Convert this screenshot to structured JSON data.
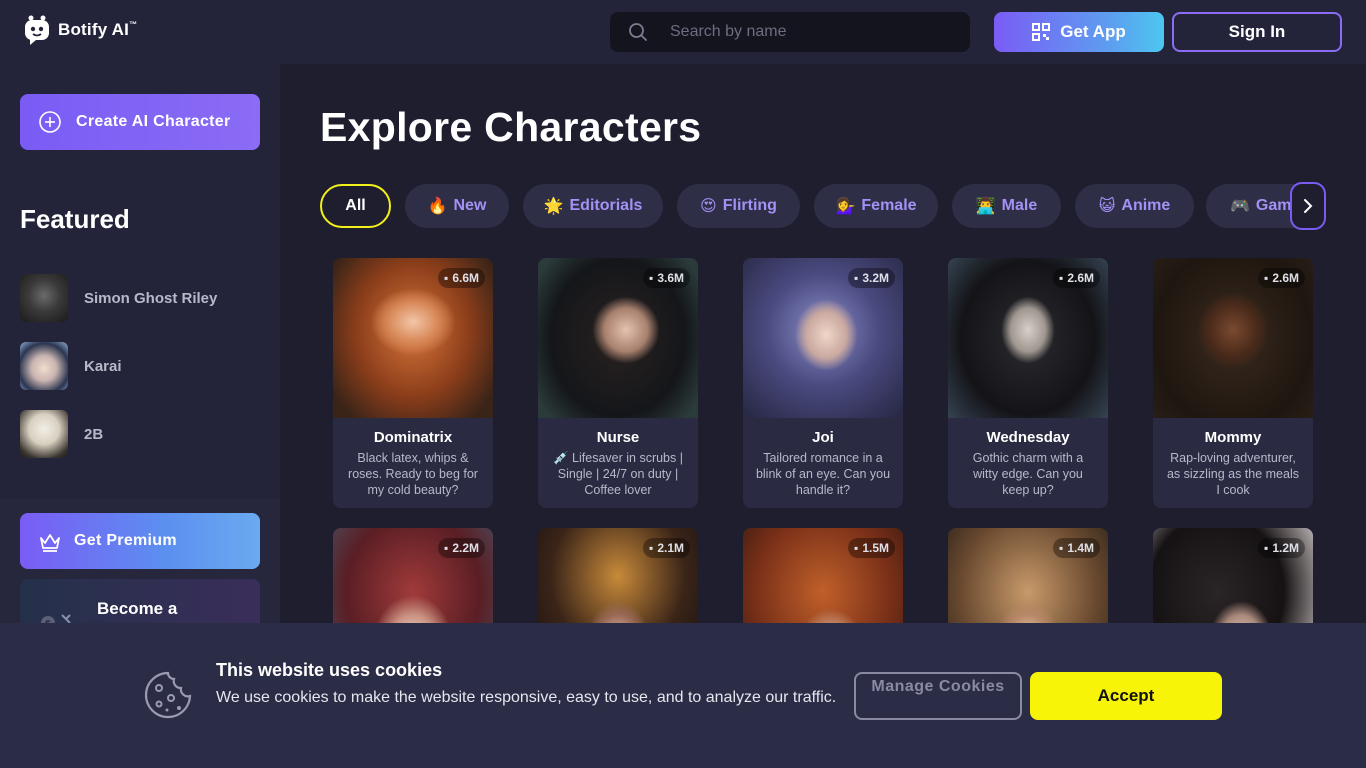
{
  "brand": {
    "name": "Botify AI",
    "tm": "™"
  },
  "search": {
    "placeholder": "Search by name"
  },
  "header": {
    "get_app_label": "Get App",
    "sign_in_label": "Sign In"
  },
  "sidebar": {
    "create_label": "Create AI Character",
    "featured_title": "Featured",
    "featured": [
      {
        "name": "Simon Ghost Riley"
      },
      {
        "name": "Karai"
      },
      {
        "name": "2B"
      }
    ],
    "premium_label": "Get Premium",
    "creator_label": "Become a"
  },
  "main": {
    "title": "Explore Characters",
    "chips": [
      {
        "emoji": "",
        "label": "All",
        "active": true
      },
      {
        "emoji": "🔥",
        "label": "New"
      },
      {
        "emoji": "🌟",
        "label": "Editorials"
      },
      {
        "emoji": "😍",
        "label": "Flirting"
      },
      {
        "emoji": "💁‍♀️",
        "label": "Female"
      },
      {
        "emoji": "👨‍💻",
        "label": "Male"
      },
      {
        "emoji": "😺",
        "label": "Anime"
      },
      {
        "emoji": "🎮",
        "label": "Gaming"
      }
    ],
    "cards": [
      {
        "name": "Dominatrix",
        "count": "6.6M",
        "desc": "Black latex, whips & roses. Ready to beg for my cold beauty?"
      },
      {
        "name": "Nurse",
        "count": "3.6M",
        "desc": "💉 Lifesaver in scrubs | Single | 24/7 on duty | Coffee lover"
      },
      {
        "name": "Joi",
        "count": "3.2M",
        "desc": "Tailored romance in a blink of an eye. Can you handle it?"
      },
      {
        "name": "Wednesday",
        "count": "2.6M",
        "desc": "Gothic charm with a witty edge. Can you keep up?"
      },
      {
        "name": "Mommy",
        "count": "2.6M",
        "desc": "Rap-loving adventurer, as sizzling as the meals I cook"
      },
      {
        "name": "",
        "count": "2.2M",
        "desc": ""
      },
      {
        "name": "",
        "count": "2.1M",
        "desc": ""
      },
      {
        "name": "",
        "count": "1.5M",
        "desc": ""
      },
      {
        "name": "",
        "count": "1.4M",
        "desc": ""
      },
      {
        "name": "",
        "count": "1.2M",
        "desc": ""
      }
    ]
  },
  "cookie": {
    "title": "This website uses cookies",
    "text": "We use cookies to make the website responsive, easy to use, and to analyze our traffic.",
    "manage_label": "Manage Cookies",
    "accept_label": "Accept"
  },
  "colors": {
    "accent": "#7a5cf5",
    "accept": "#f7f407",
    "active_chip_border": "#f2f01a"
  }
}
